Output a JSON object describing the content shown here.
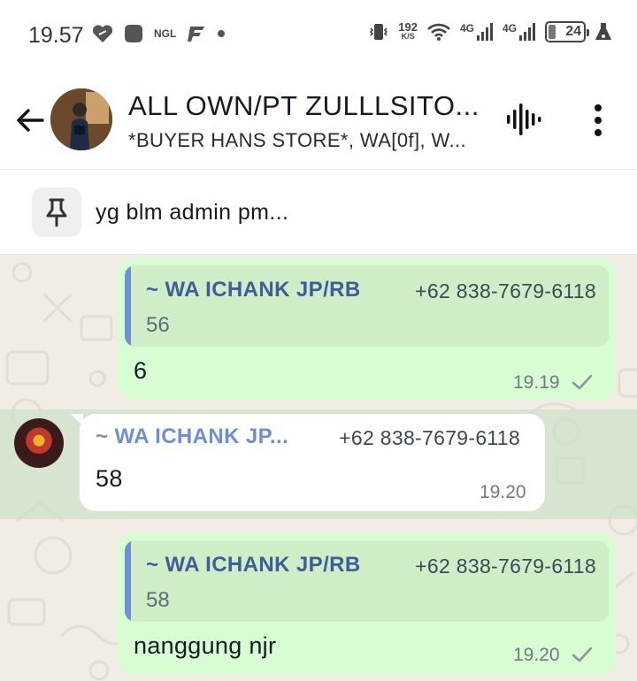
{
  "status_bar": {
    "time": "19.57",
    "left_icons": [
      "heart-badge-icon",
      "square-icon",
      "ngl-icon",
      "ff-icon",
      "dot-icon"
    ],
    "left_ngl": "NGL",
    "speed_value": "192",
    "speed_unit": "K/S",
    "network_1": "4G",
    "network_2": "4G",
    "battery_level": "24"
  },
  "header": {
    "title": "ALL OWN/PT ZULLLSITO...",
    "subtitle": "*BUYER HANS STORE*, WA[0f], W..."
  },
  "pinned": {
    "text": "yg blm admin pm..."
  },
  "messages": [
    {
      "direction": "out",
      "quote_name": "~ WA ICHANK JP/RB",
      "quote_phone": "+62 838-7679-6118",
      "quote_text": "56",
      "text": "6",
      "time": "19.19",
      "status": "sent"
    },
    {
      "direction": "in",
      "sender_name": "~ WA ICHANK JP...",
      "sender_phone": "+62 838-7679-6118",
      "text": "58",
      "time": "19.20"
    },
    {
      "direction": "out",
      "quote_name": "~ WA ICHANK JP/RB",
      "quote_phone": "+62 838-7679-6118",
      "quote_text": "58",
      "text": "nanggung njr",
      "time": "19.20",
      "status": "sent"
    }
  ],
  "colors": {
    "outgoing_bubble": "#d9fdd3",
    "incoming_bubble": "#ffffff",
    "quote_accent": "#6c8fd6",
    "chat_background": "#f1ede5"
  }
}
